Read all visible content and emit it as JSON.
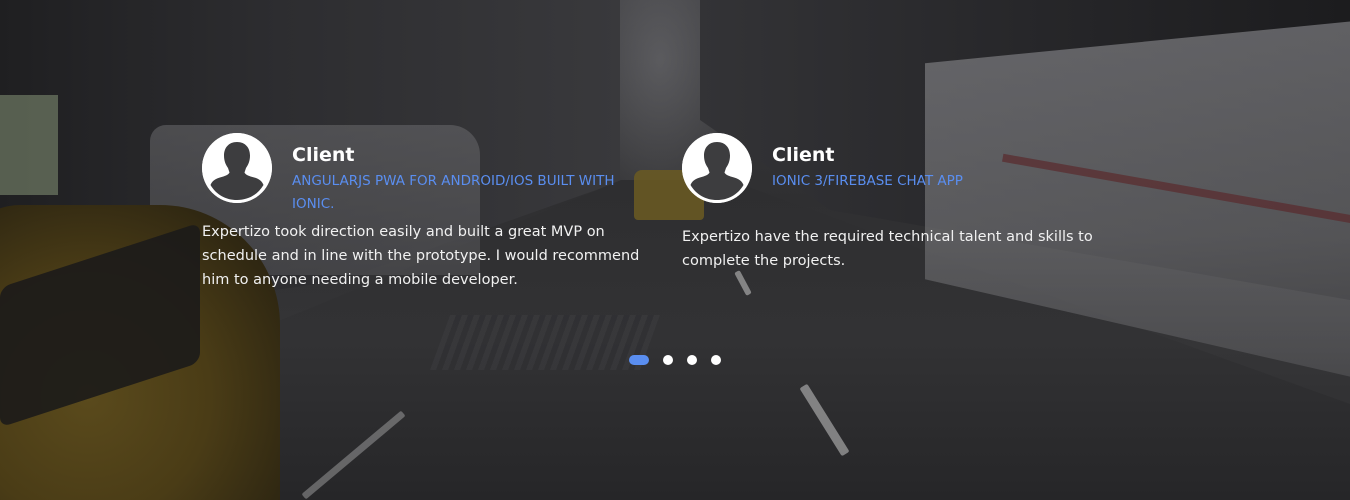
{
  "colors": {
    "accent": "#5a8ef0",
    "name": "#ffffff",
    "text": "#f1f1f1",
    "overlay": "#2a2a2c"
  },
  "testimonials": [
    {
      "avatar_icon": "user-silhouette-icon",
      "name": "Client",
      "project": "AngularJS PWA for Android/iOS built with Ionic.",
      "quote": "Expertizo took direction easily and built a great MVP on schedule and in line with the prototype. I would recommend him to anyone needing a mobile developer."
    },
    {
      "avatar_icon": "user-silhouette-icon",
      "name": "Client",
      "project": "Ionic 3/Firebase Chat App",
      "quote": "Expertizo have the required technical talent and skills to complete the projects."
    }
  ],
  "pagination": {
    "total": 4,
    "active_index": 0
  }
}
